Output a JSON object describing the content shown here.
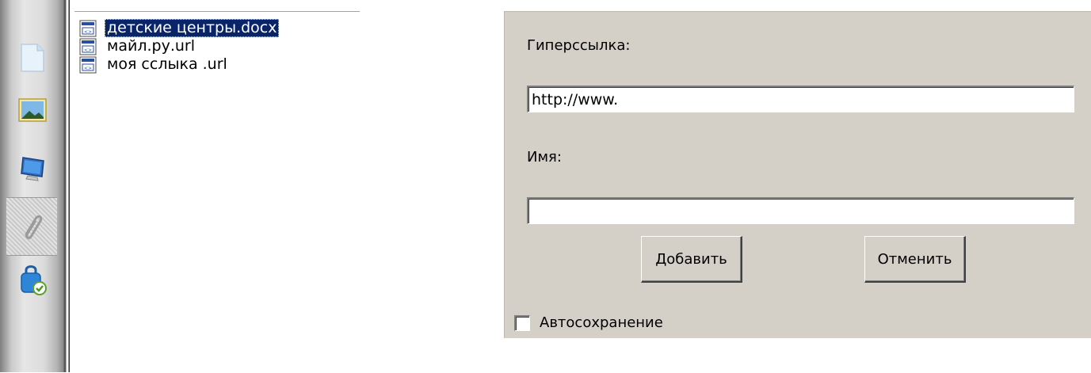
{
  "toolbar": {
    "buttons": [
      {
        "icon": "document-icon"
      },
      {
        "icon": "picture-icon"
      },
      {
        "icon": "monitor-icon"
      },
      {
        "icon": "paperclip-icon"
      },
      {
        "icon": "secure-drive-icon"
      }
    ]
  },
  "files": [
    {
      "name": "детские центры.docx",
      "icon": "url-file-icon",
      "selected": true
    },
    {
      "name": "майл.ру.url",
      "icon": "url-file-icon",
      "selected": false
    },
    {
      "name": "моя сслыка .url",
      "icon": "url-file-icon",
      "selected": false
    }
  ],
  "dialog": {
    "hyperlink_label": "Гиперссылка:",
    "hyperlink_value": "http://www.",
    "name_label": "Имя:",
    "name_value": "",
    "add_button": "Добавить",
    "cancel_button": "Отменить",
    "autosave_label": "Автосохранение",
    "autosave_checked": false
  }
}
